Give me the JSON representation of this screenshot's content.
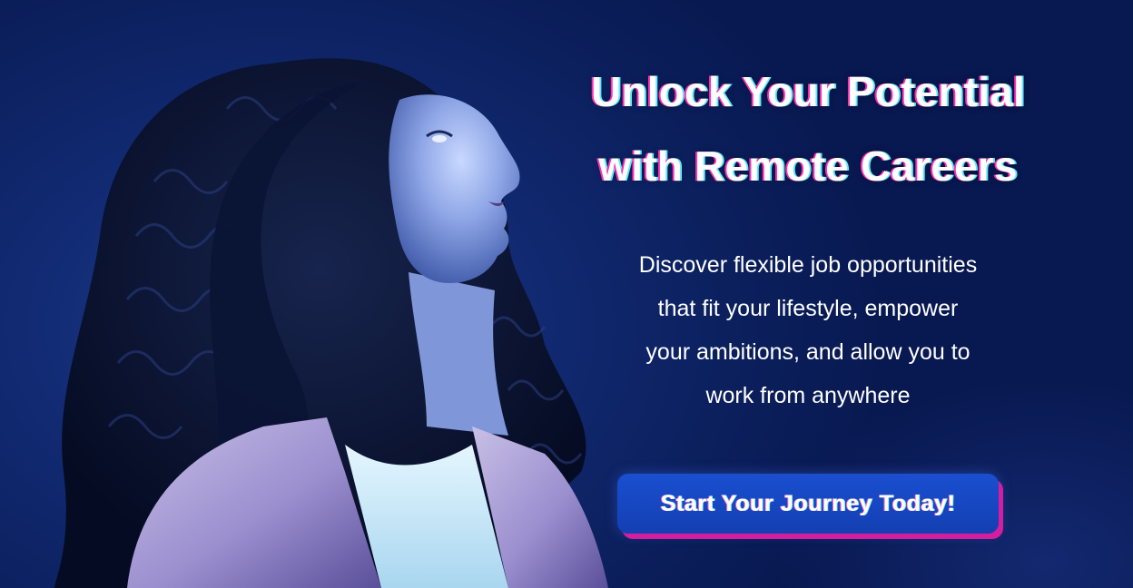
{
  "hero": {
    "headline_line1": "Unlock Your Potential",
    "headline_line2": "with Remote Careers",
    "subtext_lines": [
      "Discover flexible job opportunities",
      "that fit your lifestyle, empower",
      "your ambitions, and allow you to",
      "work from anywhere"
    ],
    "cta_label": "Start Your Journey Today!"
  },
  "image": {
    "subject": "woman-looking-up-photo"
  },
  "colors": {
    "background": "#0b1f5c",
    "button": "#1a4fd0",
    "button_shadow": "#d21e9f",
    "text": "#ffffff"
  }
}
